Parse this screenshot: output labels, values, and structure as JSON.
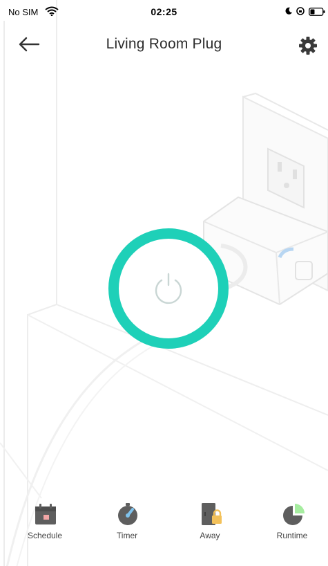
{
  "status_bar": {
    "carrier": "No SIM",
    "time": "02:25"
  },
  "header": {
    "title": "Living Room Plug",
    "back_icon": "arrow-left-icon",
    "settings_icon": "gear-icon"
  },
  "device": {
    "power_icon": "power-icon",
    "state": "off",
    "accent_color": "#1ed0b8"
  },
  "toolbar": {
    "items": [
      {
        "label": "Schedule",
        "icon": "calendar-icon"
      },
      {
        "label": "Timer",
        "icon": "stopwatch-icon"
      },
      {
        "label": "Away",
        "icon": "door-lock-icon"
      },
      {
        "label": "Runtime",
        "icon": "pie-chart-icon"
      }
    ]
  }
}
